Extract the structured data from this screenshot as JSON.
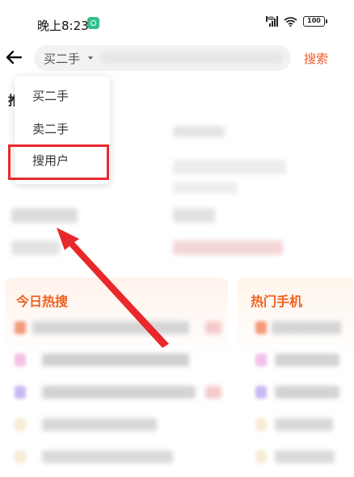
{
  "status_bar": {
    "time": "晚上8:23",
    "network_label": "HD",
    "battery": "100"
  },
  "search": {
    "type_label": "买二手",
    "button_label": "搜索"
  },
  "section": {
    "title_partial": "推"
  },
  "dropdown": {
    "items": [
      {
        "label": "买二手"
      },
      {
        "label": "卖二手"
      },
      {
        "label": "搜用户"
      }
    ],
    "highlighted_index": 2
  },
  "cards": [
    {
      "title": "今日热搜"
    },
    {
      "title": "热门手机"
    }
  ],
  "colors": {
    "accent": "#f05a2a",
    "highlight": "#e8282b",
    "arrow": "#e8282b"
  }
}
